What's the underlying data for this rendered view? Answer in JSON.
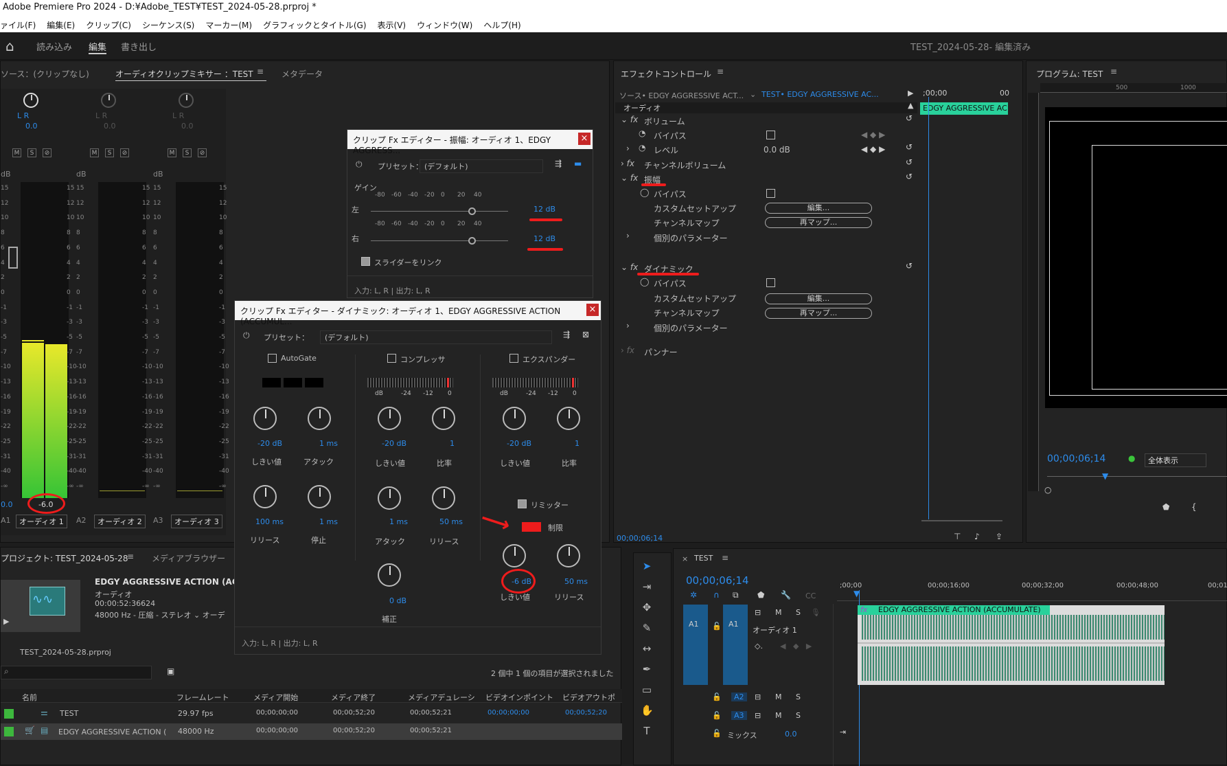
{
  "app": {
    "title": "Adobe Premiere Pro 2024 - D:¥Adobe_TEST¥TEST_2024-05-28.prproj *",
    "menu": [
      "ァイル(F)",
      "編集(E)",
      "クリップ(C)",
      "シーケンス(S)",
      "マーカー(M)",
      "グラフィックとタイトル(G)",
      "表示(V)",
      "ウィンドウ(W)",
      "ヘルプ(H)"
    ],
    "ws_tabs": [
      "読み込み",
      "編集",
      "書き出し"
    ],
    "project_status": "TEST_2024-05-28- 編集済み"
  },
  "mixer": {
    "tabs": [
      "ソース：(クリップなし)",
      "オーディオクリップミキサー ：TEST",
      "メタデータ"
    ],
    "channels": [
      {
        "id": "A1",
        "name": "オーディオ 1",
        "value": "0.0",
        "meter": "-6.0"
      },
      {
        "id": "A2",
        "name": "オーディオ 2",
        "value": "0.0"
      },
      {
        "id": "A3",
        "name": "オーディオ 3",
        "value": "0.0"
      }
    ],
    "msr": [
      "M",
      "S",
      "⊘"
    ],
    "db_label": "dB",
    "scale": [
      "15",
      "12",
      "10",
      "8",
      "6",
      "4",
      "2",
      "0",
      "-1",
      "-3",
      "-5",
      "-7",
      "-10",
      "-13",
      "-16",
      "-19",
      "-22",
      "-25",
      "-31",
      "-40",
      "-∞"
    ],
    "lr": "L   R"
  },
  "amp_dialog": {
    "title": "クリップ Fx エディター - 振幅: オーディオ 1、EDGY AGGRESS...",
    "preset_label": "プリセット：",
    "preset_value": "(デフォルト)",
    "section": "ゲイン",
    "left_label": "左",
    "right_label": "右",
    "scale": [
      "-80",
      "-60",
      "-40",
      "-20",
      "0",
      "20",
      "40"
    ],
    "left_val": "12 dB",
    "right_val": "12 dB",
    "link": "スライダーをリンク",
    "io": "入力: L, R | 出力: L, R"
  },
  "dyn_dialog": {
    "title": "クリップ Fx エディター - ダイナミック: オーディオ 1、EDGY AGGRESSIVE ACTION (ACCUMUL...",
    "preset_label": "プリセット：",
    "preset_value": "(デフォルト)",
    "autogate": "AutoGate",
    "compressor": "コンプレッサ",
    "expander": "エクスパンダー",
    "ag": {
      "th_val": "-20 dB",
      "th": "しきい値",
      "at_val": "1 ms",
      "at": "アタック",
      "rel_val": "100 ms",
      "rel": "リリース",
      "hold_val": "1 ms",
      "hold": "停止"
    },
    "comp": {
      "th_val": "-20 dB",
      "th": "しきい値",
      "ratio_val": "1",
      "ratio": "比率",
      "at_val": "1 ms",
      "at": "アタック",
      "rel_val": "50 ms",
      "rel": "リリース",
      "mk_val": "0 dB",
      "mk": "補正",
      "scale": [
        "dB",
        "-24",
        "-12",
        "0"
      ]
    },
    "exp": {
      "th_val": "-20 dB",
      "th": "しきい値",
      "ratio_val": "1",
      "ratio": "比率",
      "scale": [
        "dB",
        "-24",
        "-12",
        "0"
      ]
    },
    "limiter": "リミッター",
    "limit": "制限",
    "lim": {
      "th_val": "-6 dB",
      "th": "しきい値",
      "rel_val": "50 ms",
      "rel": "リリース"
    },
    "io": "入力: L, R | 出力: L, R"
  },
  "effects": {
    "title": "エフェクトコントロール",
    "source": "ソース• EDGY AGGRESSIVE ACT...",
    "seq": "TEST• EDGY AGGRESSIVE AC...",
    "time_start": ";00;00",
    "time_end": "00",
    "clip": "EDGY AGGRESSIVE AC",
    "audio": "オーディオ",
    "volume": "ボリューム",
    "bypass": "バイパス",
    "level": "レベル",
    "level_val": "0.0 dB",
    "chvol": "チャンネルボリューム",
    "amp": "振幅",
    "custom": "カスタムセットアップ",
    "chmap": "チャンネルマップ",
    "params": "個別のパラメーター",
    "edit": "編集...",
    "remap": "再マップ...",
    "dynamics": "ダイナミック",
    "panner": "パンナー",
    "timecode": "00;00;06;14"
  },
  "program": {
    "title": "プログラム: TEST",
    "timecode": "00;00;06;14",
    "fit": "全体表示",
    "ruler": [
      "500",
      "1000"
    ]
  },
  "project": {
    "tabs": [
      "プロジェクト: TEST_2024-05-28",
      "メディアブラウザー"
    ],
    "clip_name": "EDGY AGGRESSIVE ACTION (ACCU",
    "clip_type": "オーディオ",
    "clip_dur": "00:00:52:36624",
    "clip_fmt": "48000 Hz - 圧縮 - ステレオ ⌄ オーデ",
    "file": "TEST_2024-05-28.prproj",
    "selection": "2 個中 1 個の項目が選択されました",
    "columns": [
      "名前",
      "フレームレート",
      "メディア開始",
      "メディア終了",
      "メディアデュレーシ",
      "ビデオインポイント",
      "ビデオアウトポ"
    ],
    "rows": [
      {
        "name": "TEST",
        "fps": "29.97 fps",
        "start": "00;00;00;00",
        "end": "00;00;52;20",
        "dur": "00;00;52;21",
        "in": "00;00;00;00",
        "out": "00;00;52;20"
      },
      {
        "name": "EDGY AGGRESSIVE ACTION (",
        "fps": "48000 Hz",
        "start": "00;00;00;00",
        "end": "00;00;52;20",
        "dur": "00;00;52;21",
        "in": "",
        "out": ""
      }
    ]
  },
  "timeline": {
    "title": "TEST",
    "timecode": "00;00;06;14",
    "ruler": [
      ";00;00",
      "00;00;16;00",
      "00;00;32;00",
      "00;00;48;00",
      "00;01"
    ],
    "clip": "EDGY AGGRESSIVE ACTION (ACCUMULATE)",
    "tracks": [
      "A1",
      "A2",
      "A3"
    ],
    "track_name": "オーディオ 1",
    "mix": "ミックス",
    "mix_val": "0.0",
    "fx": "fx"
  },
  "colors": {
    "accent": "#2d8ceb",
    "clip": "#29d19b",
    "annot": "#ee1c1c"
  }
}
